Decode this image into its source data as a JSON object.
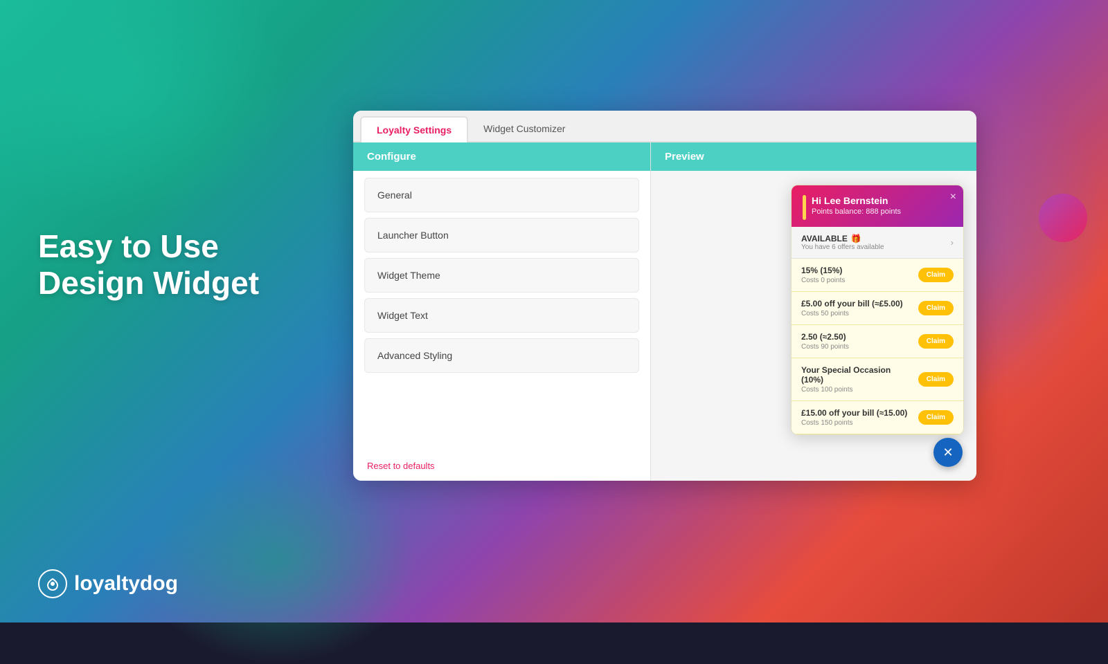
{
  "background": {
    "color": "#1abc9c"
  },
  "hero": {
    "line1": "Easy to Use",
    "line2": "Design Widget"
  },
  "logo": {
    "text": "loyaltydog"
  },
  "tabs": {
    "loyalty_settings": "Loyalty Settings",
    "widget_customizer": "Widget Customizer",
    "active": "loyalty_settings"
  },
  "configure": {
    "header": "Configure",
    "items": [
      {
        "label": "General"
      },
      {
        "label": "Launcher Button"
      },
      {
        "label": "Widget Theme"
      },
      {
        "label": "Widget Text"
      },
      {
        "label": "Advanced Styling"
      }
    ],
    "reset_label": "Reset to defaults"
  },
  "preview": {
    "header": "Preview",
    "widget": {
      "greeting": "Hi Lee Bernstein",
      "points_balance": "Points balance: 888 points",
      "available_label": "AVAILABLE",
      "available_sub": "You have 6 offers available",
      "offers": [
        {
          "name": "15% (15%)",
          "cost": "Costs 0 points"
        },
        {
          "name": "£5.00 off your bill (≈£5.00)",
          "cost": "Costs 50 points"
        },
        {
          "name": "2.50 (≈2.50)",
          "cost": "Costs 90 points"
        },
        {
          "name": "Your Special Occasion (10%)",
          "cost": "Costs 100 points"
        },
        {
          "name": "£15.00 off your bill (≈15.00)",
          "cost": "Costs 150 points"
        }
      ],
      "claim_label": "Claim",
      "close_label": "×"
    }
  }
}
